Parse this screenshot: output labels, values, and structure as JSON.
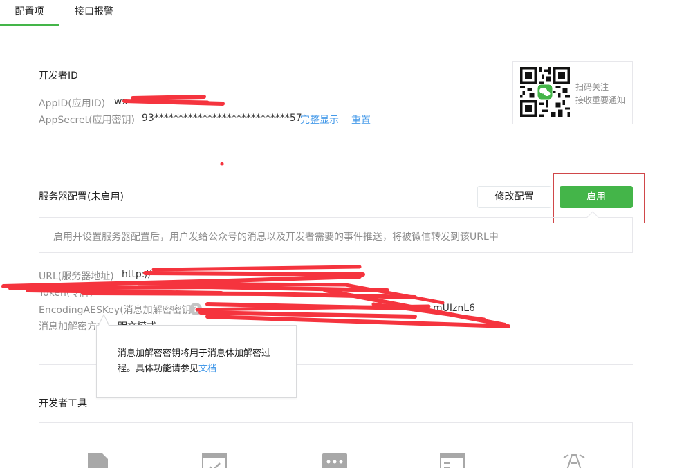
{
  "tabs": [
    {
      "label": "配置项",
      "active": true
    },
    {
      "label": "接口报警",
      "active": false
    }
  ],
  "developer_id": {
    "title": "开发者ID",
    "appid_label": "AppID(应用ID)",
    "appid_value": "wx",
    "appsecret_label": "AppSecret(应用密钥)",
    "appsecret_value": "93****************************57",
    "show_full_link": "完整显示",
    "reset_link": "重置"
  },
  "qr": {
    "line1": "扫码关注",
    "line2": "接收重要通知"
  },
  "server_config": {
    "title": "服务器配置(未启用)",
    "modify_button": "修改配置",
    "enable_button": "启用",
    "tip": "启用并设置服务器配置后，用户发给公众号的消息以及开发者需要的事件推送，将被微信转发到该URL中",
    "url_label": "URL(服务器地址)",
    "url_value": "http://",
    "token_label": "Token(令牌)",
    "token_value": "",
    "aes_label": "EncodingAESKey(消息加解密密钥",
    "aes_value_end": "mUIznL6",
    "help_icon_char": "?",
    "mode_label": "消息加解密方式",
    "mode_value": "明文模式"
  },
  "popover": {
    "text": "消息加解密密钥将用于消息体加解密过程。具体功能请参见",
    "link": "文档"
  },
  "developer_tools": {
    "title": "开发者工具"
  },
  "colors": {
    "accent": "#44b549",
    "link": "#459ae9",
    "redaction": "#f5343e"
  }
}
